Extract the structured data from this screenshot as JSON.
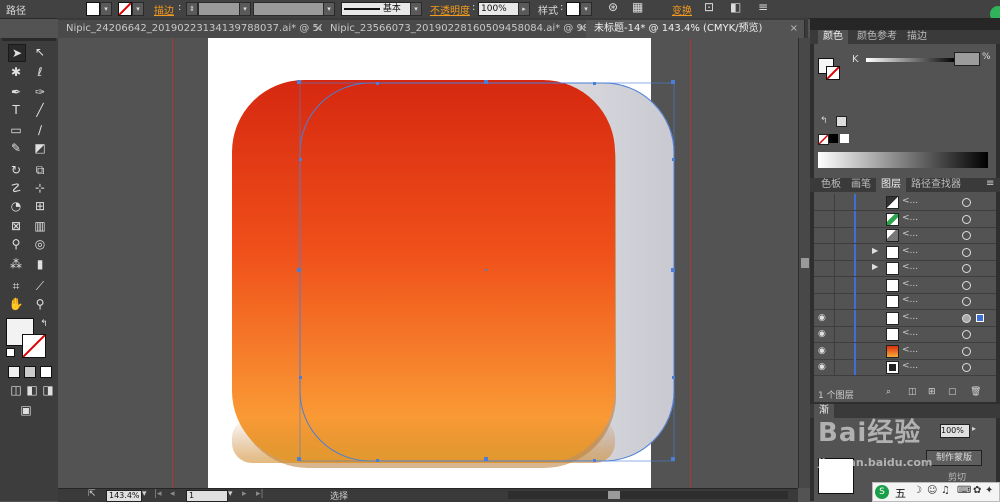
{
  "control_bar": {
    "path_label": "路径",
    "stroke_label": "描边",
    "stroke_style": "基本",
    "opacity_label": "不透明度",
    "opacity_value": "100%",
    "style_label": "样式",
    "transform_label": "变换"
  },
  "tabs": [
    {
      "label": "Nipic_24206642_20190223134139788037.ai* @ 50...",
      "close": "×"
    },
    {
      "label": "Nipic_23566073_20190228160509458084.ai* @ 98...",
      "close": "×"
    },
    {
      "label": "未标题-14* @ 143.4% (CMYK/预览)",
      "close": "×"
    }
  ],
  "tools": {
    "icons": [
      "selection",
      "direct-selection",
      "magic-wand",
      "lasso",
      "pen",
      "curvature",
      "type",
      "line",
      "rectangle",
      "paintbrush",
      "pencil",
      "eraser",
      "rotate",
      "scale",
      "warp",
      "free-transform",
      "shape-builder",
      "perspective",
      "mesh",
      "gradient",
      "eyedropper",
      "blend",
      "symbol-sprayer",
      "graph",
      "artboard",
      "slice",
      "hand",
      "zoom"
    ]
  },
  "right_panel": {
    "color_tabs": [
      "颜色",
      "颜色参考",
      "描边"
    ],
    "k_label": "K",
    "layer_tabs": [
      "色板",
      "画笔",
      "图层",
      "路径查找器"
    ],
    "layers_count": "1 个图层",
    "layer_rows": [
      {
        "visible": false,
        "name": "<...",
        "thumb": "diag-dark",
        "expand": false
      },
      {
        "visible": false,
        "name": "<...",
        "thumb": "diag-green",
        "expand": false
      },
      {
        "visible": false,
        "name": "<...",
        "thumb": "diag-gray",
        "expand": false
      },
      {
        "visible": false,
        "name": "<...",
        "thumb": "white",
        "expand": true
      },
      {
        "visible": false,
        "name": "<...",
        "thumb": "white",
        "expand": true
      },
      {
        "visible": false,
        "name": "<...",
        "thumb": "white",
        "expand": false
      },
      {
        "visible": false,
        "name": "<...",
        "thumb": "white",
        "expand": false
      },
      {
        "visible": true,
        "name": "<...",
        "thumb": "white",
        "expand": false,
        "selected": true
      },
      {
        "visible": true,
        "name": "<...",
        "thumb": "white",
        "expand": false
      },
      {
        "visible": true,
        "name": "<...",
        "thumb": "orange",
        "expand": false
      },
      {
        "visible": true,
        "name": "<...",
        "thumb": "dark",
        "expand": false
      }
    ],
    "bottom_label_left": "渐",
    "percent_value": "100%",
    "make_mask_button": "制作蒙版",
    "cut_label": "剪切"
  },
  "status_bar": {
    "zoom": "143.4%",
    "page": "1",
    "mode": "选择"
  },
  "watermark": {
    "line1": "Bai",
    "line2": "经验",
    "line3": "jingyan.baidu.com"
  },
  "ime": {
    "label": "五"
  },
  "colors": {
    "gradient_top": "#d82810",
    "gradient_mid": "#f04a14",
    "gradient_bottom": "#fbab3a",
    "selection_blue": "#4a7fd8"
  }
}
